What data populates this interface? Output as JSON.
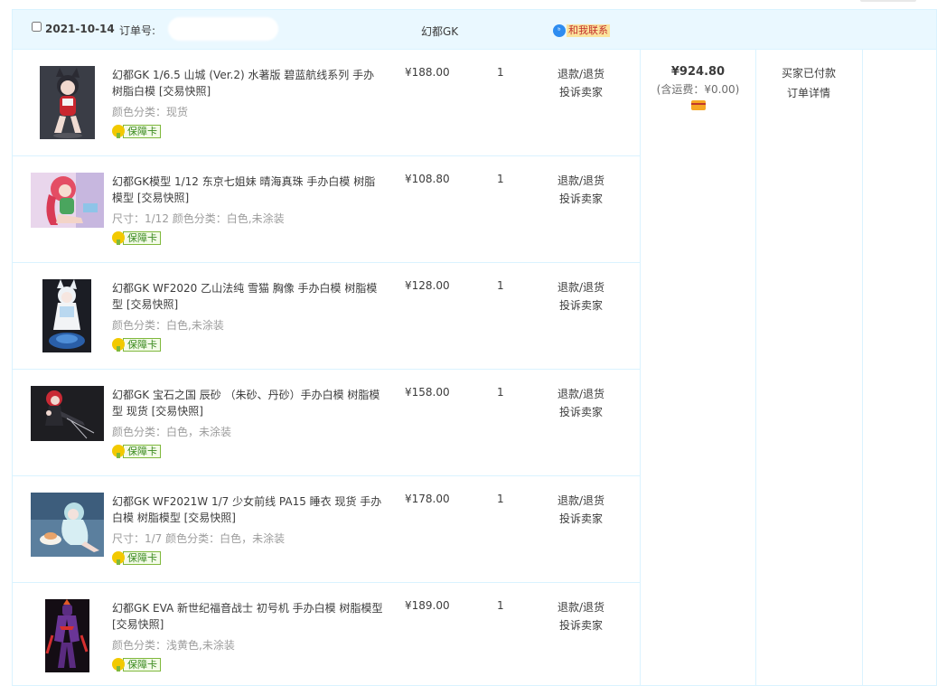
{
  "order": {
    "date": "2021-10-14",
    "order_no_label": "订单号:",
    "shop": "幻都GK",
    "contact_label": "和我联系",
    "contact_icon_text": "ᵇ",
    "total": {
      "amount": "¥924.80",
      "shipping": "(含运费：¥0.00)"
    },
    "status": "买家已付款",
    "detail_link": "订单详情"
  },
  "labels": {
    "guarantee": "保障卡",
    "refund": "退款/退货",
    "complaint": "投诉卖家"
  },
  "items": [
    {
      "title": "幻都GK 1/6.5 山城 (Ver.2) 水著版 碧蓝航线系列 手办树脂白模 [交易快照]",
      "props": "颜色分类：现货",
      "price": "¥188.00",
      "qty": "1"
    },
    {
      "title": "幻都GK模型 1/12 东京七姐妹 晴海真珠 手办白模 树脂模型 [交易快照]",
      "props": "尺寸：1/12   颜色分类：白色,未涂装",
      "price": "¥108.80",
      "qty": "1"
    },
    {
      "title": "幻都GK WF2020 乙山法纯 雪猫 胸像 手办白模 树脂模型 [交易快照]",
      "props": "颜色分类：白色,未涂装",
      "price": "¥128.00",
      "qty": "1"
    },
    {
      "title": "幻都GK 宝石之国 辰砂 （朱砂、丹砂）手办白模 树脂模型 现货 [交易快照]",
      "props": "颜色分类：白色，未涂装",
      "price": "¥158.00",
      "qty": "1"
    },
    {
      "title": "幻都GK WF2021W 1/7 少女前线 PA15 睡衣 现货 手办白模 树脂模型 [交易快照]",
      "props": "尺寸：1/7   颜色分类：白色，未涂装",
      "price": "¥178.00",
      "qty": "1"
    },
    {
      "title": "幻都GK EVA 新世纪福音战士 初号机 手办白模 树脂模型 [交易快照]",
      "props": "颜色分类：浅黄色,未涂装",
      "price": "¥189.00",
      "qty": "1"
    }
  ]
}
